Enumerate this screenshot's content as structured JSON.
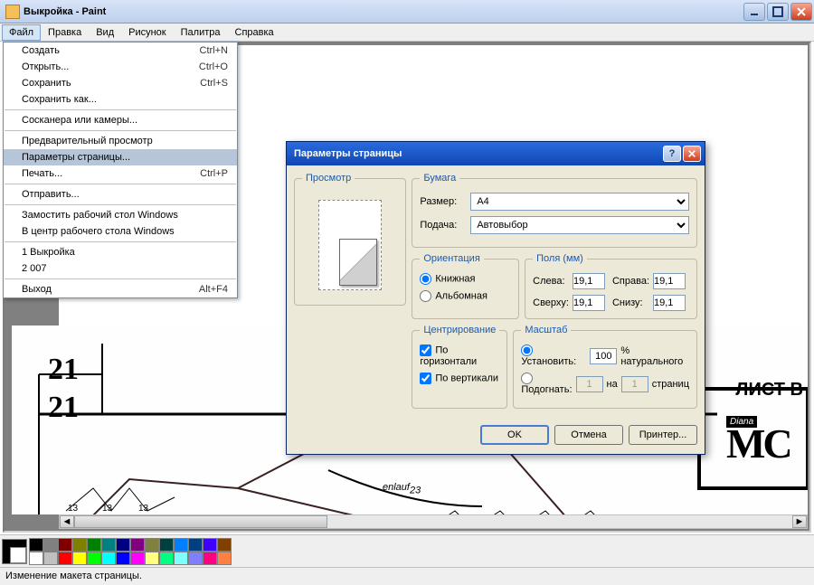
{
  "window": {
    "title": "Выкройка - Paint"
  },
  "menubar": {
    "items": [
      "Файл",
      "Правка",
      "Вид",
      "Рисунок",
      "Палитра",
      "Справка"
    ]
  },
  "dropdown": {
    "i0": {
      "label": "Создать",
      "accel": "Ctrl+N"
    },
    "i1": {
      "label": "Открыть...",
      "accel": "Ctrl+O"
    },
    "i2": {
      "label": "Сохранить",
      "accel": "Ctrl+S"
    },
    "i3": {
      "label": "Сохранить как...",
      "accel": ""
    },
    "i4": {
      "label": "Сосканера или камеры...",
      "accel": ""
    },
    "i5": {
      "label": "Предварительный просмотр",
      "accel": ""
    },
    "i6": {
      "label": "Параметры страницы...",
      "accel": ""
    },
    "i7": {
      "label": "Печать...",
      "accel": "Ctrl+P"
    },
    "i8": {
      "label": "Отправить...",
      "accel": ""
    },
    "i9": {
      "label": "Замостить рабочий стол Windows",
      "accel": ""
    },
    "i10": {
      "label": "В центр рабочего стола Windows",
      "accel": ""
    },
    "i11": {
      "label": "1 Выкройка",
      "accel": ""
    },
    "i12": {
      "label": "2 007",
      "accel": ""
    },
    "i13": {
      "label": "Выход",
      "accel": "Alt+F4"
    }
  },
  "canvas": {
    "n21a": "21",
    "n21b": "21",
    "curve_label": "enlauf",
    "curve_num": "23",
    "small_nums": "13",
    "sheet": "ЛИСТ В",
    "logo_text": "Diana"
  },
  "palette": {
    "row1": [
      "#000000",
      "#808080",
      "#800000",
      "#808000",
      "#008000",
      "#008080",
      "#000080",
      "#800080",
      "#808040",
      "#004040",
      "#0080ff",
      "#004080",
      "#4000ff",
      "#804000"
    ],
    "row2": [
      "#ffffff",
      "#c0c0c0",
      "#ff0000",
      "#ffff00",
      "#00ff00",
      "#00ffff",
      "#0000ff",
      "#ff00ff",
      "#ffff80",
      "#00ff80",
      "#80ffff",
      "#8080ff",
      "#ff0080",
      "#ff8040"
    ]
  },
  "status": {
    "text": "Изменение макета страницы."
  },
  "dialog": {
    "title": "Параметры страницы",
    "preview_legend": "Просмотр",
    "paper": {
      "legend": "Бумага",
      "size_label": "Размер:",
      "size_value": "A4",
      "source_label": "Подача:",
      "source_value": "Автовыбор"
    },
    "orientation": {
      "legend": "Ориентация",
      "portrait": "Книжная",
      "landscape": "Альбомная"
    },
    "margins": {
      "legend": "Поля (мм)",
      "left": "Слева:",
      "right": "Справа:",
      "top": "Сверху:",
      "bottom": "Снизу:",
      "val": "19,1"
    },
    "centering": {
      "legend": "Центрирование",
      "horiz": "По горизонтали",
      "vert": "По вертикали"
    },
    "scale": {
      "legend": "Масштаб",
      "set": "Установить:",
      "set_val": "100",
      "set_suffix": "% натурального",
      "fit": "Подогнать:",
      "fit_a": "1",
      "fit_mid": "на",
      "fit_b": "1",
      "fit_suffix": "страниц"
    },
    "buttons": {
      "ok": "OK",
      "cancel": "Отмена",
      "printer": "Принтер..."
    }
  }
}
